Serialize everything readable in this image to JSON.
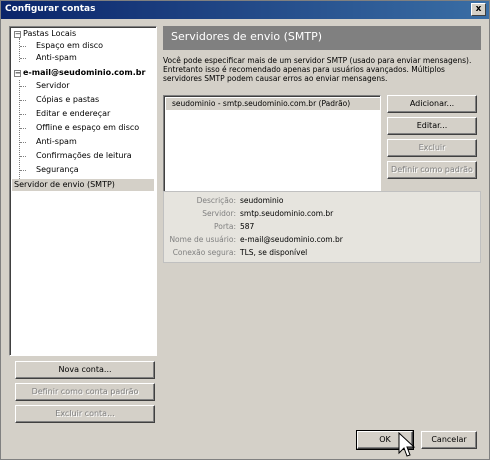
{
  "window": {
    "title": "Configurar contas",
    "close_label": "x"
  },
  "tree": {
    "items": [
      {
        "label": "Pastas Locais",
        "expander": "−"
      },
      {
        "label": "Espaço em disco"
      },
      {
        "label": "Anti-spam"
      },
      {
        "label": "e-mail@seudominio.com.br",
        "expander": "−"
      },
      {
        "label": "Servidor"
      },
      {
        "label": "Cópias e pastas"
      },
      {
        "label": "Editar e endereçar"
      },
      {
        "label": "Offline e espaço em disco"
      },
      {
        "label": "Anti-spam"
      },
      {
        "label": "Confirmações de leitura"
      },
      {
        "label": "Segurança"
      },
      {
        "label": "Servidor de envio (SMTP)"
      }
    ]
  },
  "left_buttons": {
    "new_account": "Nova conta...",
    "set_default": "Definir como conta padrão",
    "delete_account": "Excluir conta..."
  },
  "panel": {
    "title": "Servidores de envio (SMTP)",
    "description": "Você pode especificar mais de um servidor SMTP (usado para enviar mensagens). Entretanto isso é recomendado apenas para usuários avançados. Múltiplos servidores SMTP podem causar erros ao enviar mensagens.",
    "servers": [
      "seudominio - smtp.seudominio.com.br (Padrão)"
    ],
    "buttons": {
      "add": "Adicionar...",
      "edit": "Editar...",
      "delete": "Excluir",
      "set_default": "Definir como padrão"
    },
    "details": [
      {
        "label": "Descrição:",
        "value": "seudominio"
      },
      {
        "label": "Servidor:",
        "value": "smtp.seudominio.com.br"
      },
      {
        "label": "Porta:",
        "value": "587"
      },
      {
        "label": "Nome de usuário:",
        "value": "e-mail@seudominio.com.br"
      },
      {
        "label": "Conexão segura:",
        "value": "TLS, se disponível"
      }
    ]
  },
  "footer": {
    "ok": "OK",
    "cancel": "Cancelar"
  }
}
